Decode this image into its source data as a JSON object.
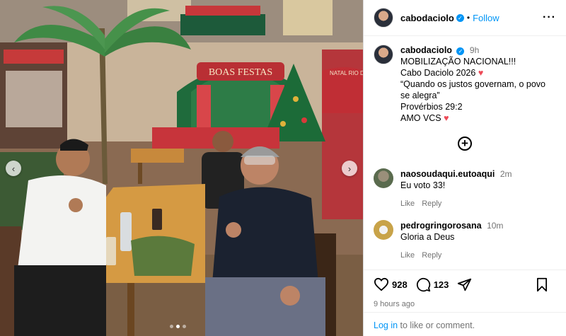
{
  "post": {
    "author": "cabodaciolo",
    "follow_label": "Follow",
    "separator": "•",
    "more_icon": "more-horizontal-icon",
    "time_ago": "9h",
    "caption_lines": [
      "MOBILIZAÇÃO NACIONAL!!!",
      "Cabo Daciolo 2026",
      "“Quando os justos governam, o povo se alegra”",
      "Provérbios 29:2",
      "AMO VCS"
    ],
    "heart_emoji": "♥"
  },
  "photo": {
    "sign_text": "BOAS FESTAS",
    "side_sign_text": "NATAL RIO DES",
    "carousel_count": 3,
    "active_index": 1,
    "prev_icon": "chevron-left-icon",
    "next_icon": "chevron-right-icon"
  },
  "more_comments_icon": "plus-circle-icon",
  "comments": [
    {
      "user": "naosoudaqui.eutoaqui",
      "time": "2m",
      "text": "Eu voto 33!",
      "like_label": "Like",
      "reply_label": "Reply"
    },
    {
      "user": "pedrogringorosana",
      "time": "10m",
      "text": "Gloria a Deus",
      "like_label": "Like",
      "reply_label": "Reply"
    }
  ],
  "actions": {
    "likes": "928",
    "comments": "123",
    "posted": "9 hours ago"
  },
  "login": {
    "link": "Log in",
    "rest": " to like or comment."
  },
  "colors": {
    "accent": "#0095f6",
    "heart": "#ed4956",
    "muted": "#737373"
  }
}
